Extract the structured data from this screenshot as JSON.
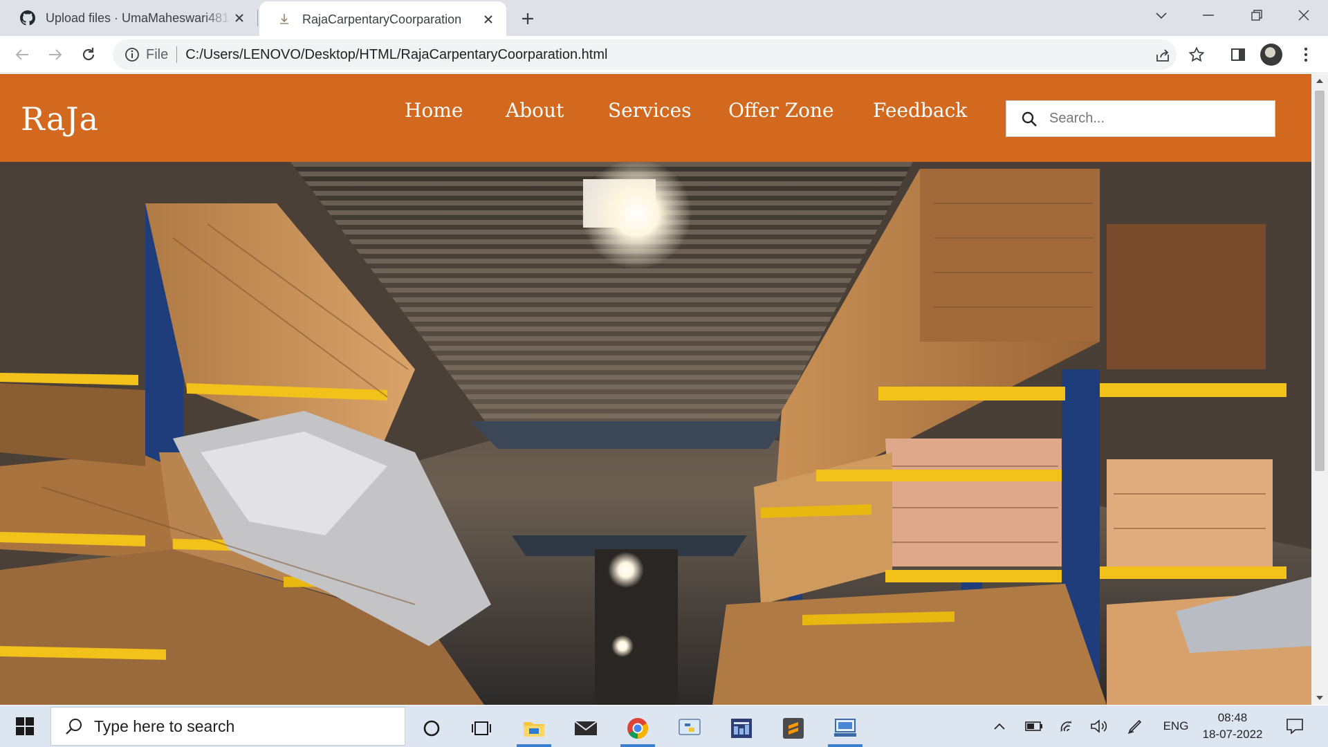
{
  "browser": {
    "tabs": [
      {
        "title": "Upload files · UmaMaheswari481",
        "favicon": "github-icon",
        "active": false
      },
      {
        "title": "RajaCarpentaryCoorparation",
        "favicon": "file-icon",
        "active": true
      }
    ],
    "address": {
      "scheme_label": "File",
      "url": "C:/Users/LENOVO/Desktop/HTML/RajaCarpentaryCoorparation.html"
    }
  },
  "site": {
    "brand": "RaJa",
    "nav": [
      "Home",
      "About",
      "Services",
      "Offer Zone",
      "Feedback"
    ],
    "search_placeholder": "Search...",
    "hero_image": "lumber-warehouse-photo",
    "accent_color": "#d2691e"
  },
  "taskbar": {
    "search_placeholder": "Type here to search",
    "apps": [
      "cortana-icon",
      "task-view-icon",
      "file-explorer-icon",
      "mail-icon",
      "chrome-icon",
      "python-icon",
      "app-icon",
      "sublime-text-icon",
      "network-app-icon"
    ],
    "language": "ENG",
    "time": "08:48",
    "date": "18-07-2022"
  }
}
